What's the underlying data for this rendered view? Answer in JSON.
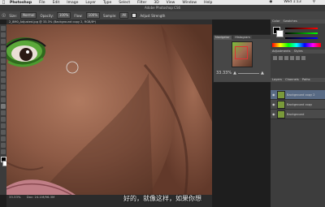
{
  "menubar": {
    "apple_icon": "apple-icon",
    "app_name": "Photoshop",
    "items": [
      "File",
      "Edit",
      "Image",
      "Layer",
      "Type",
      "Select",
      "Filter",
      "3D",
      "View",
      "Window",
      "Help"
    ],
    "clock": "Wed 1:13"
  },
  "window": {
    "title": "Adobe Photoshop CS6"
  },
  "options": {
    "size_label": "Size:",
    "size_value": "Normal",
    "opacity_label": "Opacity:",
    "opacity_value": "100%",
    "flow_label": "Flow:",
    "flow_value": "100%",
    "sample_label": "Sample:",
    "sample_value": "All",
    "adjust_label": "Adjust Strength"
  },
  "document": {
    "tab": "2_8M0_Adjusted.jpg @ 33.3% (Background copy 2, RGB/8*)",
    "zoom": "33.33%",
    "status": "Doc: 24.1M/96.3M"
  },
  "navigator": {
    "tabs": [
      "Navigator",
      "Histogram"
    ],
    "zoom": "33.33%"
  },
  "rightcol": {
    "tabs": [
      "Color",
      "Swatches",
      "Adjustments",
      "Styles"
    ],
    "layers_tabs": [
      "Layers",
      "Channels",
      "Paths"
    ],
    "layers": [
      {
        "name": "Background copy 2",
        "selected": true
      },
      {
        "name": "Background copy",
        "selected": false
      },
      {
        "name": "Background",
        "selected": false
      }
    ]
  },
  "subtitle": "好的，就像这样，如果你想"
}
